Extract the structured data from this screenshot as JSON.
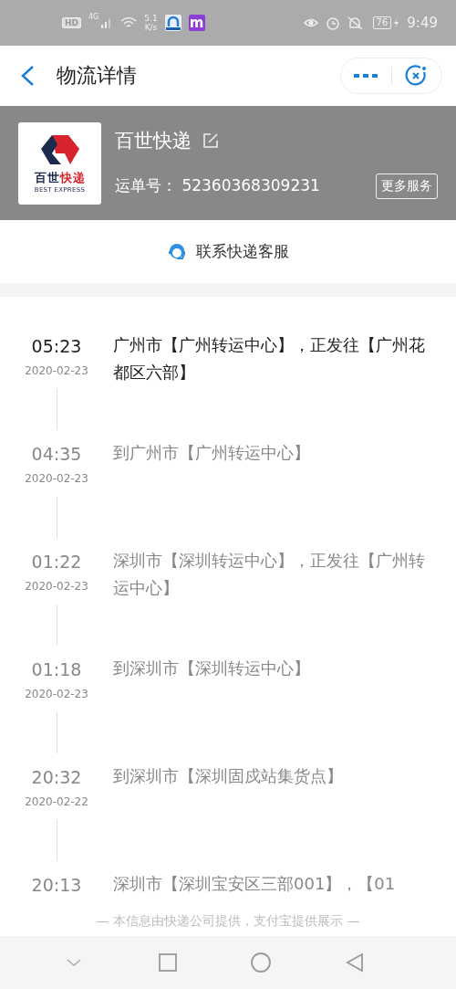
{
  "status_bar": {
    "hd": "HD",
    "network": "4G",
    "speed": [
      "5.1",
      "K/s"
    ],
    "app_letter": "m",
    "battery": "76",
    "time": "9:49"
  },
  "header": {
    "title": "物流详情"
  },
  "courier": {
    "name": "百世快递",
    "logo_cn": [
      "百世",
      "快递"
    ],
    "logo_en": "BEST EXPRESS",
    "waybill_label": "运单号：",
    "waybill_number": "52360368309231",
    "more_button": "更多服务"
  },
  "contact": {
    "label": "联系快递客服"
  },
  "tracking": [
    {
      "time": "05:23",
      "date": "2020-02-23",
      "text": "广州市【广州转运中心】，正发往【广州花都区六部】",
      "current": true
    },
    {
      "time": "04:35",
      "date": "2020-02-23",
      "text": "到广州市【广州转运中心】",
      "current": false
    },
    {
      "time": "01:22",
      "date": "2020-02-23",
      "text": "深圳市【深圳转运中心】，正发往【广州转运中心】",
      "current": false
    },
    {
      "time": "01:18",
      "date": "2020-02-23",
      "text": "到深圳市【深圳转运中心】",
      "current": false
    },
    {
      "time": "20:32",
      "date": "2020-02-22",
      "text": "到深圳市【深圳固戍站集货点】",
      "current": false
    },
    {
      "time": "20:13",
      "text": "深圳市【深圳宝安区三部001】，【01",
      "current": false
    }
  ],
  "footer": {
    "note": "— 本信息由快递公司提供，支付宝提供展示 —"
  }
}
